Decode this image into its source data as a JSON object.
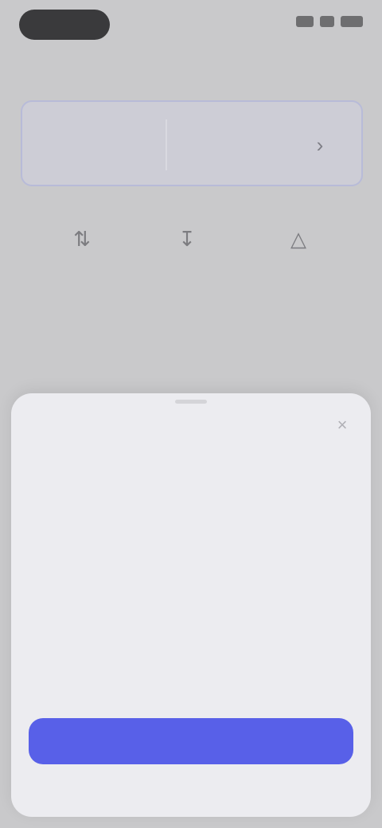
{
  "status_bar": {
    "time": "",
    "icons": [
      "signal-icon",
      "wifi-icon",
      "battery-icon"
    ]
  },
  "nav": {
    "title": ""
  },
  "account_card": {
    "name": "",
    "subtitle": "",
    "chevron_icon": "chevron-right-icon"
  },
  "quick_actions": [
    {
      "icon": "transfer-icon",
      "label": ""
    },
    {
      "icon": "deposit-icon",
      "label": ""
    },
    {
      "icon": "profile-icon",
      "label": ""
    }
  ],
  "sections": [
    {
      "label": ""
    },
    {
      "label": ""
    }
  ],
  "sheet": {
    "title": "",
    "close_icon": "close-icon",
    "body": "",
    "link": "",
    "center_text": "",
    "button_label": ""
  },
  "colors": {
    "accent": "#5860e8",
    "background": "#c9c9cb",
    "sheet": "#ececf0"
  }
}
